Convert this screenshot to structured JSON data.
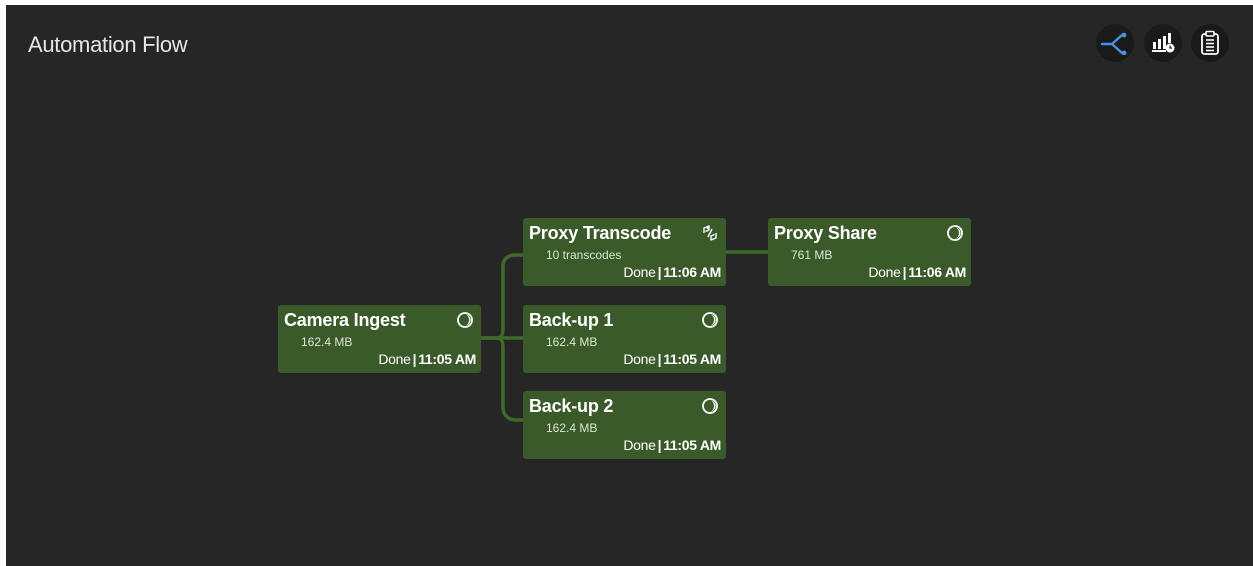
{
  "app": {
    "title": "Automation Flow"
  },
  "toolbar": {
    "buttons": [
      {
        "icon": "flow-branch-icon",
        "color": "#4a8fe0"
      },
      {
        "icon": "bar-chart-clock-icon",
        "color": "#ffffff"
      },
      {
        "icon": "clipboard-list-icon",
        "color": "#ffffff"
      }
    ]
  },
  "colors": {
    "background": "#262626",
    "node_fill": "#3a5a2a",
    "connector": "#3e6b2a",
    "accent": "#4a8fe0"
  },
  "nodes": {
    "camera_ingest": {
      "name": "Camera Ingest",
      "detail": "162.4 MB",
      "status": "Done",
      "time": "11:05 AM",
      "icon": "progress-ring-icon"
    },
    "proxy_transcode": {
      "name": "Proxy Transcode",
      "detail": "10 transcodes",
      "status": "Done",
      "time": "11:06 AM",
      "icon": "transcode-icon"
    },
    "proxy_share": {
      "name": "Proxy Share",
      "detail": "761 MB",
      "status": "Done",
      "time": "11:06 AM",
      "icon": "progress-ring-icon"
    },
    "backup_1": {
      "name": "Back-up 1",
      "detail": "162.4 MB",
      "status": "Done",
      "time": "11:05 AM",
      "icon": "progress-ring-icon"
    },
    "backup_2": {
      "name": "Back-up 2",
      "detail": "162.4 MB",
      "status": "Done",
      "time": "11:05 AM",
      "icon": "progress-ring-icon"
    }
  },
  "edges": [
    {
      "from": "Camera Ingest",
      "to": "Proxy Transcode"
    },
    {
      "from": "Camera Ingest",
      "to": "Back-up 1"
    },
    {
      "from": "Camera Ingest",
      "to": "Back-up 2"
    },
    {
      "from": "Proxy Transcode",
      "to": "Proxy Share"
    }
  ]
}
